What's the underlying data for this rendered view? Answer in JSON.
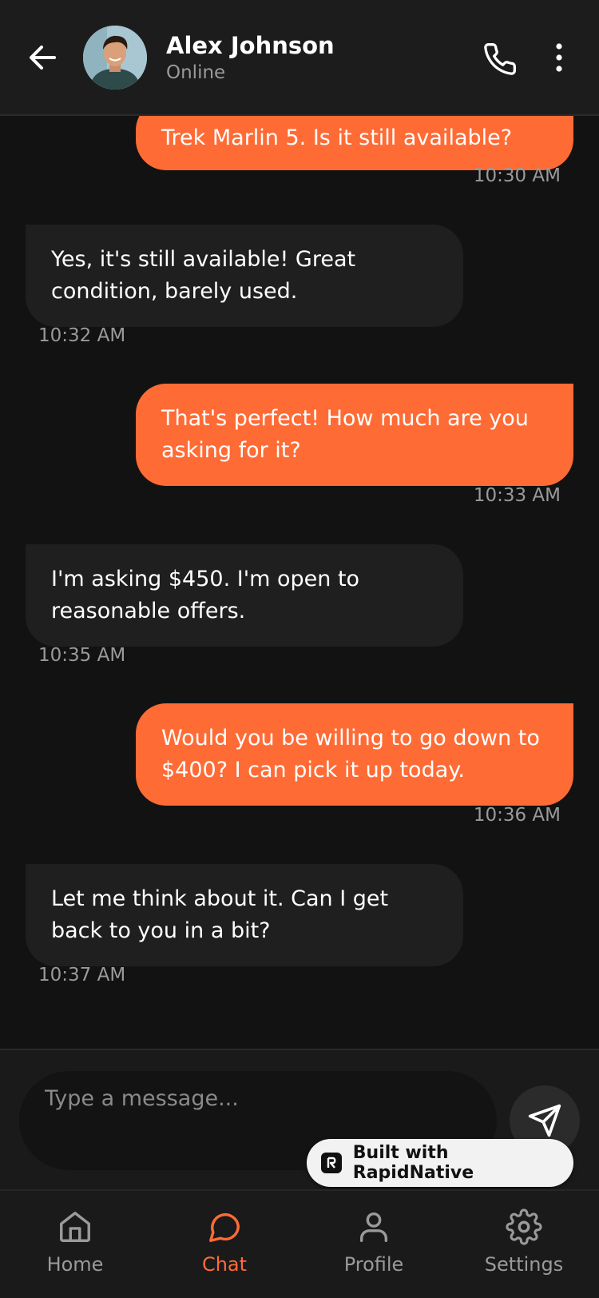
{
  "header": {
    "contact_name": "Alex Johnson",
    "status": "Online"
  },
  "messages": [
    {
      "sender": "me",
      "text": "Trek Marlin 5. Is it still available?",
      "time": "10:30 AM"
    },
    {
      "sender": "them",
      "text": "Yes, it's still available! Great condition, barely used.",
      "time": "10:32 AM"
    },
    {
      "sender": "me",
      "text": "That's perfect! How much are you asking for it?",
      "time": "10:33 AM"
    },
    {
      "sender": "them",
      "text": "I'm asking $450. I'm open to reasonable offers.",
      "time": "10:35 AM"
    },
    {
      "sender": "me",
      "text": "Would you be willing to go down to $400? I can pick it up today.",
      "time": "10:36 AM"
    },
    {
      "sender": "them",
      "text": "Let me think about it. Can I get back to you in a bit?",
      "time": "10:37 AM"
    }
  ],
  "composer": {
    "placeholder": "Type a message..."
  },
  "badge": {
    "label": "Built with RapidNative"
  },
  "tabs": [
    {
      "label": "Home",
      "icon": "home-icon",
      "active": false
    },
    {
      "label": "Chat",
      "icon": "chat-icon",
      "active": true
    },
    {
      "label": "Profile",
      "icon": "profile-icon",
      "active": false
    },
    {
      "label": "Settings",
      "icon": "settings-icon",
      "active": false
    }
  ],
  "colors": {
    "accent": "#ff6b35",
    "background": "#121212",
    "received_bubble": "#1f1f1f",
    "muted_text": "#9a9a9a"
  }
}
